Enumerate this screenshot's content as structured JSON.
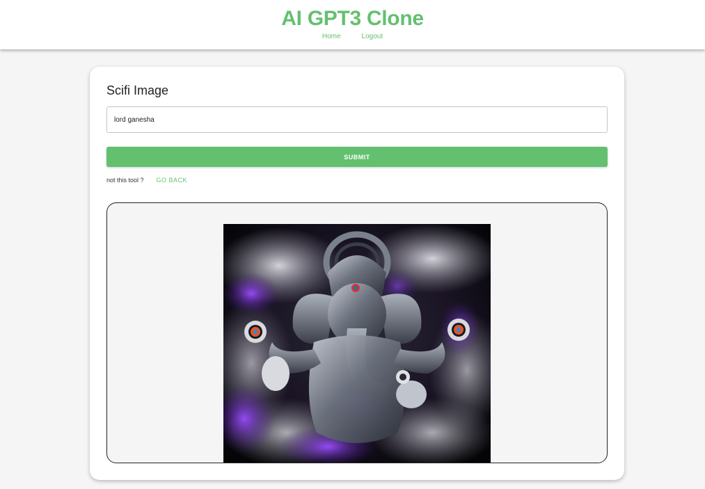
{
  "header": {
    "title": "AI GPT3 Clone",
    "nav": [
      {
        "label": "Home"
      },
      {
        "label": "Logout"
      }
    ]
  },
  "tool": {
    "title": "Scifi Image",
    "prompt_value": "lord ganesha",
    "submit_label": "SUBMIT",
    "not_this_tool": "not this tool ?",
    "go_back_label": "GO BACK"
  },
  "result": {
    "image_subject": "ganesha-scifi-artwork"
  },
  "colors": {
    "accent": "#63c06f",
    "page_background": "#f5f5f5"
  }
}
